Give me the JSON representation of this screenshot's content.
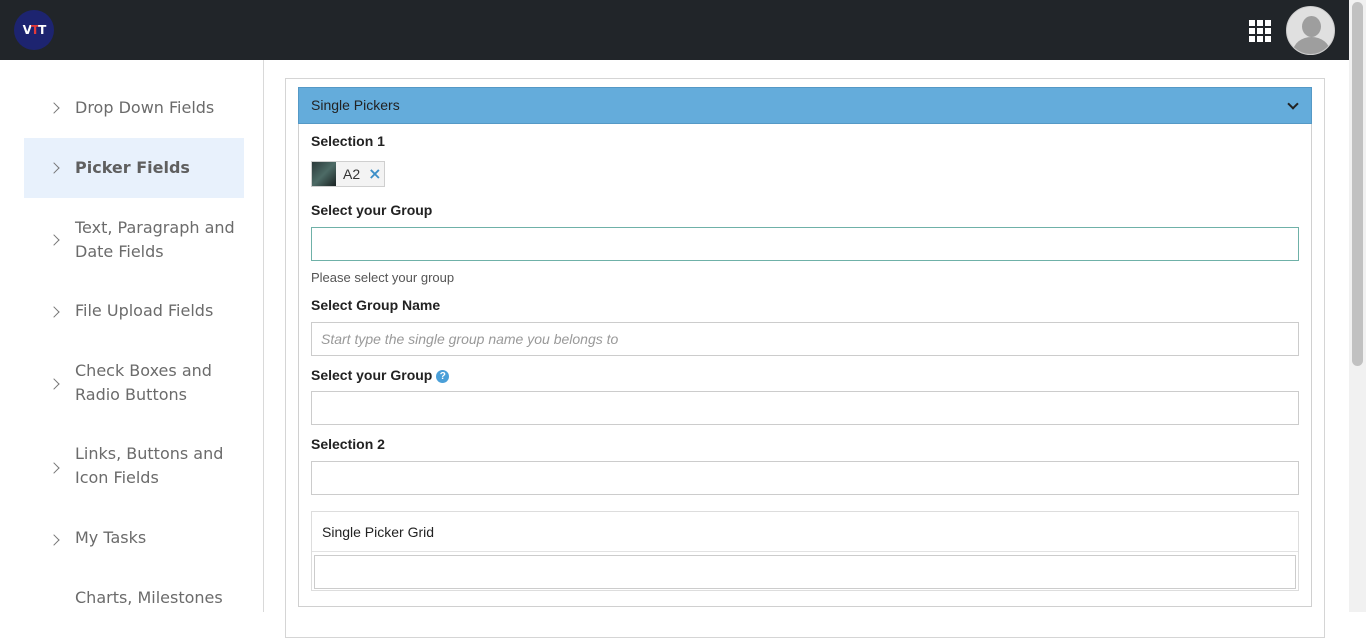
{
  "header": {
    "logo_text": "VTT",
    "apps_icon": "apps-grid-icon",
    "avatar_icon": "user-avatar-icon"
  },
  "sidebar": {
    "items": [
      {
        "label": "Drop Down Fields",
        "active": false
      },
      {
        "label": "Picker Fields",
        "active": true
      },
      {
        "label": "Text, Paragraph and Date Fields",
        "active": false
      },
      {
        "label": "File Upload Fields",
        "active": false
      },
      {
        "label": "Check Boxes and Radio Buttons",
        "active": false
      },
      {
        "label": "Links, Buttons and Icon Fields",
        "active": false
      },
      {
        "label": "My Tasks",
        "active": false
      },
      {
        "label": "Charts, Milestones",
        "active": false
      }
    ]
  },
  "panel": {
    "title": "Single Pickers",
    "header_color": "#64acdb"
  },
  "fields": {
    "selection1": {
      "label": "Selection 1",
      "chip_text": "A2"
    },
    "group": {
      "label": "Select your Group",
      "value": "",
      "help": "Please select your group"
    },
    "group_name": {
      "label": "Select Group Name",
      "placeholder": "Start type the single group name you belongs to"
    },
    "group2": {
      "label": "Select your Group",
      "value": ""
    },
    "selection2": {
      "label": "Selection 2",
      "value": ""
    },
    "grid": {
      "title": "Single Picker Grid"
    }
  }
}
